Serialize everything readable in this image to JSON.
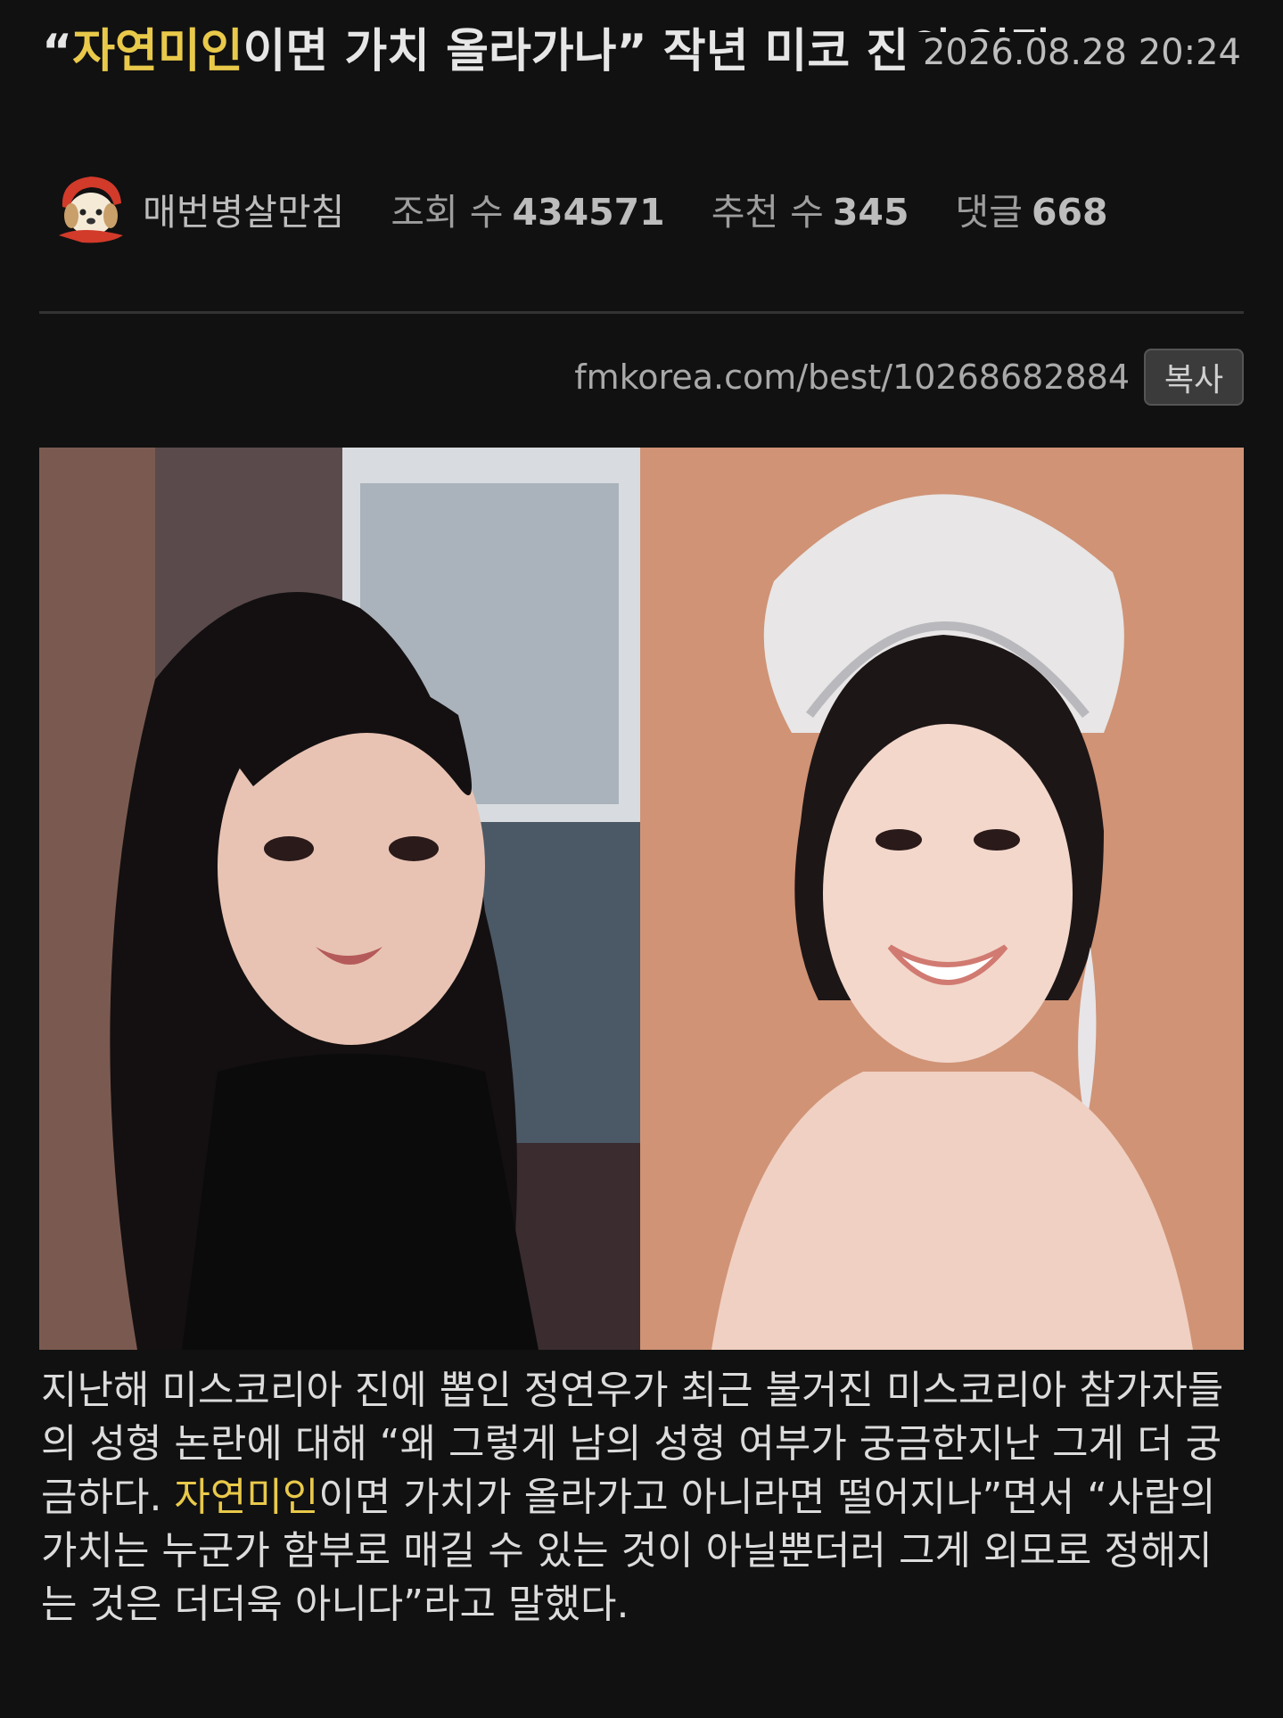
{
  "post": {
    "title_prefix": "“",
    "title_highlight": "자연미인",
    "title_suffix": "이면 가치 올라가나” 작년 미코 진의 일갈",
    "date": "2026.08.28 20:24",
    "author": "매번병살만침",
    "views_label": "조회 수",
    "views": "434571",
    "recommend_label": "추천 수",
    "recommend": "345",
    "comments_label": "댓글",
    "comments": "668",
    "url": "fmkorea.com/best/10268682884",
    "copy_label": "복사",
    "body_before": "지난해 미스코리아 진에 뽑인 정연우가 최근 불거진 미스코리아 참가자들의 성형 논란에 대해 “왜 그렇게 남의 성형 여부가 궁금한지난 그게 더 궁금하다. ",
    "body_highlight": "자연미인",
    "body_after": "이면 가치가 올라가고 아니라면 떨어지나”면서 “사람의 가치는 누군가 함부로 매길 수 있는 것이 아닐뿐더러 그게 외모로 정해지는 것은 더더욱 아니다”라고 말했다."
  },
  "colors": {
    "background": "#111111",
    "highlight": "#e9c94a"
  }
}
